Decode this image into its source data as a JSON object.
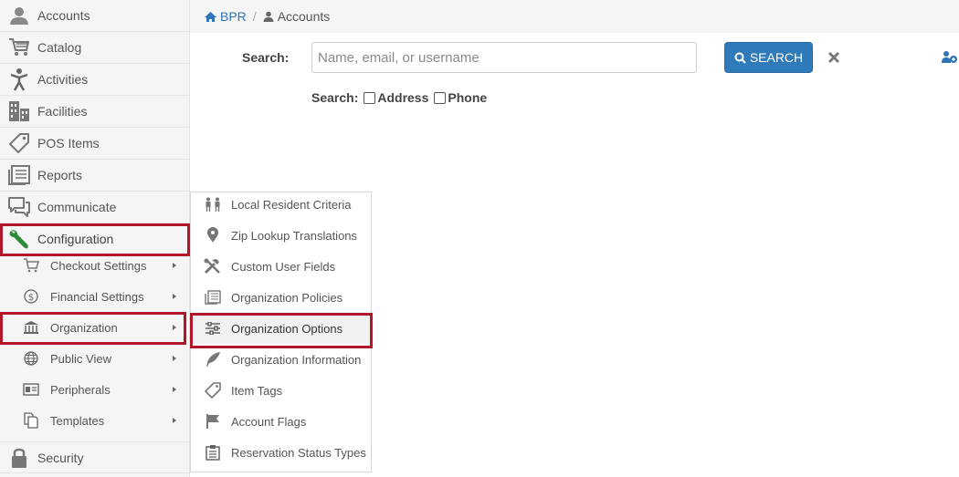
{
  "breadcrumb": {
    "home": "BPR",
    "separator": "/",
    "current": "Accounts"
  },
  "search": {
    "label": "Search:",
    "placeholder": "Name, email, or username",
    "value": "",
    "button_label": "SEARCH",
    "options_label": "Search:",
    "option_address": "Address",
    "option_phone": "Phone"
  },
  "sidebar": {
    "items": [
      {
        "label": "Accounts",
        "icon": "user-icon"
      },
      {
        "label": "Catalog",
        "icon": "cart-icon"
      },
      {
        "label": "Activities",
        "icon": "activity-person-icon"
      },
      {
        "label": "Facilities",
        "icon": "building-icon"
      },
      {
        "label": "POS Items",
        "icon": "tag-icon"
      },
      {
        "label": "Reports",
        "icon": "reports-icon"
      },
      {
        "label": "Communicate",
        "icon": "chat-icon"
      },
      {
        "label": "Configuration",
        "icon": "wrench-icon"
      }
    ],
    "config_subitems": [
      {
        "label": "Checkout Settings",
        "icon": "cart-icon"
      },
      {
        "label": "Financial Settings",
        "icon": "dollar-circle-icon"
      },
      {
        "label": "Organization",
        "icon": "bank-icon"
      },
      {
        "label": "Public View",
        "icon": "globe-icon"
      },
      {
        "label": "Peripherals",
        "icon": "id-card-icon"
      },
      {
        "label": "Templates",
        "icon": "copy-icon"
      }
    ],
    "security_label": "Security"
  },
  "flyout": {
    "items": [
      {
        "label": "Local Resident Criteria",
        "icon": "people-icon"
      },
      {
        "label": "Zip Lookup Translations",
        "icon": "map-pin-icon"
      },
      {
        "label": "Custom User Fields",
        "icon": "tools-icon"
      },
      {
        "label": "Organization Policies",
        "icon": "policies-icon"
      },
      {
        "label": "Organization Options",
        "icon": "sliders-icon"
      },
      {
        "label": "Organization Information",
        "icon": "feather-icon"
      },
      {
        "label": "Item Tags",
        "icon": "tag-icon"
      },
      {
        "label": "Account Flags",
        "icon": "flag-icon"
      },
      {
        "label": "Reservation Status Types",
        "icon": "clipboard-icon"
      }
    ]
  },
  "colors": {
    "accent": "#2f7ab8",
    "highlight": "#b0182a",
    "wrench": "#2e8b3a"
  }
}
